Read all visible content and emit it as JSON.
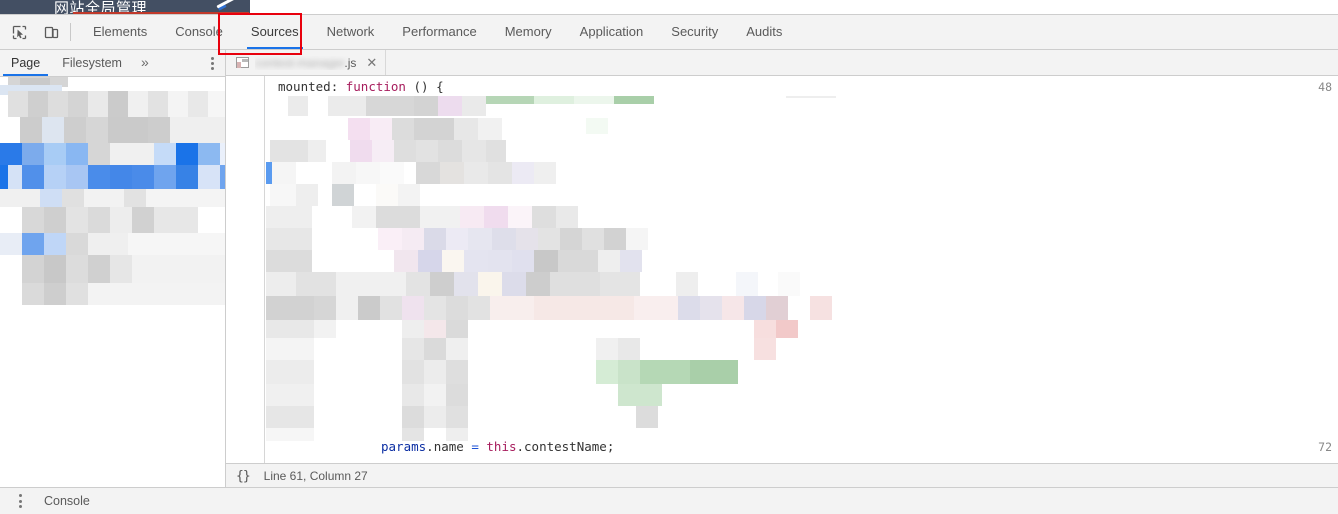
{
  "page": {
    "title": "网站全局管理"
  },
  "devtools": {
    "toolbar": {
      "inspect_icon": "inspect-element-icon",
      "device_icon": "device-toolbar-icon"
    },
    "main_tabs": [
      {
        "label": "Elements",
        "active": false
      },
      {
        "label": "Console",
        "active": false
      },
      {
        "label": "Sources",
        "active": true
      },
      {
        "label": "Network",
        "active": false
      },
      {
        "label": "Performance",
        "active": false
      },
      {
        "label": "Memory",
        "active": false
      },
      {
        "label": "Application",
        "active": false
      },
      {
        "label": "Security",
        "active": false
      },
      {
        "label": "Audits",
        "active": false
      }
    ],
    "annotation": {
      "target": "Sources",
      "color": "#e8000d"
    },
    "navigator": {
      "tabs": [
        {
          "label": "Page",
          "active": true
        },
        {
          "label": "Filesystem",
          "active": false
        }
      ],
      "more_icon": "chevron-double-right-icon",
      "menu_icon": "kebab-menu-icon",
      "tree_status": "redacted"
    },
    "file_tabs": [
      {
        "name_visible": ".js",
        "name_blurred": "contest-manager",
        "icon": "javascript-file-icon",
        "close_icon": "close-icon",
        "active": true
      }
    ],
    "editor": {
      "first_line_number": "48",
      "first_line_code": "mounted: function () {",
      "last_line_number": "72",
      "last_line_code": "params.name = this.contestName;",
      "body_status": "redacted"
    },
    "editor_status": {
      "pretty_print_icon": "{}",
      "cursor_position": "Line 61, Column 27"
    },
    "drawer": {
      "menu_icon": "kebab-menu-icon",
      "tab_label": "Console"
    }
  },
  "colors": {
    "accent": "#1a73e8",
    "annotation": "#e8000d",
    "header_bar": "#434f63",
    "chrome_bg": "#f3f3f3"
  }
}
